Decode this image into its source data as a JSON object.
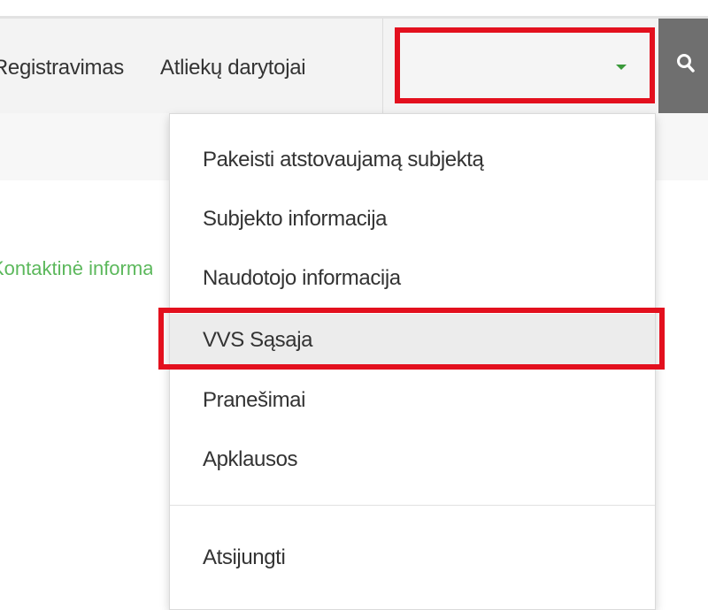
{
  "navbar": {
    "links": [
      {
        "label": "Registravimas"
      },
      {
        "label": "Atliekų darytojai"
      }
    ],
    "user_select": {
      "value": ""
    },
    "search": {
      "icon": "search-icon"
    }
  },
  "contact_link": {
    "label": "Kontaktinė informacija"
  },
  "user_menu": {
    "items": [
      {
        "label": "Pakeisti atstovaujamą subjektą"
      },
      {
        "label": "Subjekto informacija"
      },
      {
        "label": "Naudotojo informacija"
      },
      {
        "label": "VVS Sąsaja"
      },
      {
        "label": "Pranešimai"
      },
      {
        "label": "Apklausos"
      },
      {
        "label": "Atsijungti"
      }
    ]
  },
  "colors": {
    "highlight": "#e3101e",
    "link_green": "#5cb85c",
    "search_bg": "#6f6f6f",
    "navbar_bg": "#f3f3f3"
  }
}
